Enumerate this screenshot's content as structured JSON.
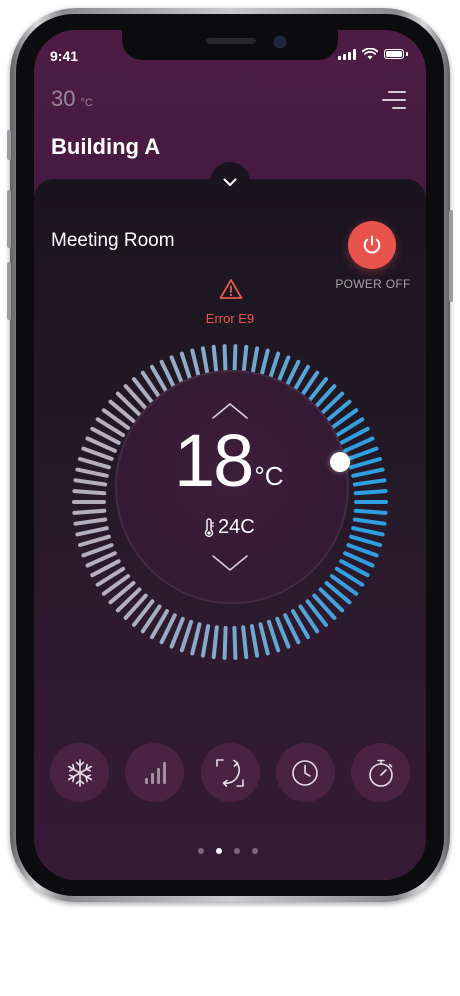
{
  "status_bar": {
    "time": "9:41"
  },
  "header": {
    "outside_temp": "30",
    "outside_temp_unit": "°C",
    "building": "Building A"
  },
  "room": {
    "name": "Meeting Room",
    "power_label": "POWER OFF",
    "error": "Error E9"
  },
  "thermostat": {
    "set_temp": "18",
    "unit": "°C",
    "room_temp": "24C",
    "dial_level": 0.38
  },
  "modes": [
    "snowflake-icon",
    "fan-speed-icon",
    "swing-icon",
    "clock-icon",
    "timer-icon"
  ],
  "pager": {
    "count": 4,
    "active": 1
  },
  "colors": {
    "background_top": "#4a1b42",
    "card_dark": "#1a1420",
    "power_red": "#e8544d",
    "error_red": "#e35b51",
    "dial_blue": "#2e9fe0",
    "dial_gray": "#b4aebe"
  }
}
